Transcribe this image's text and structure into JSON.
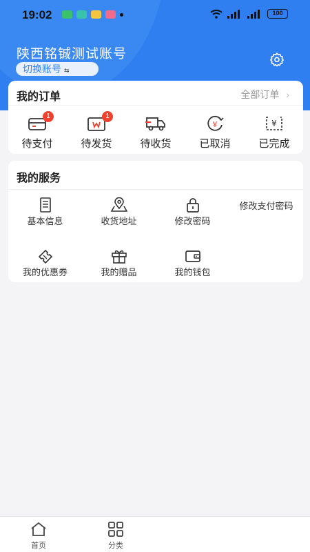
{
  "status_bar": {
    "time": "19:02",
    "battery": "100"
  },
  "header": {
    "account_name": "陕西铭铖测试账号",
    "switch_label": "切换账号",
    "switch_icon": "⇆"
  },
  "orders": {
    "title": "我的订单",
    "all_label": "全部订单",
    "items": [
      {
        "label": "待支付",
        "badge": "1",
        "icon": "wallet-icon"
      },
      {
        "label": "待发货",
        "badge": "1",
        "icon": "package-icon"
      },
      {
        "label": "待收货",
        "icon": "truck-icon"
      },
      {
        "label": "已取消",
        "icon": "cancel-yen-icon"
      },
      {
        "label": "已完成",
        "icon": "receipt-icon"
      }
    ]
  },
  "services": {
    "title": "我的服务",
    "items": [
      {
        "label": "基本信息",
        "icon": "document-icon"
      },
      {
        "label": "收货地址",
        "icon": "map-pin-icon"
      },
      {
        "label": "修改密码",
        "icon": "lock-icon"
      },
      {
        "label": "修改支付密码",
        "icon": "wallet-lock-icon"
      },
      {
        "label": "我的优惠券",
        "icon": "coupon-icon"
      },
      {
        "label": "我的赠品",
        "icon": "gift-icon"
      },
      {
        "label": "我的钱包",
        "icon": "wallet-icon"
      }
    ]
  },
  "tabbar": {
    "items": [
      {
        "label": "首页",
        "icon": "home-icon"
      },
      {
        "label": "分类",
        "icon": "grid-icon"
      }
    ]
  },
  "colors": {
    "primary": "#2f7ff0",
    "badge": "#f0412f",
    "background": "#f4f4f6"
  }
}
